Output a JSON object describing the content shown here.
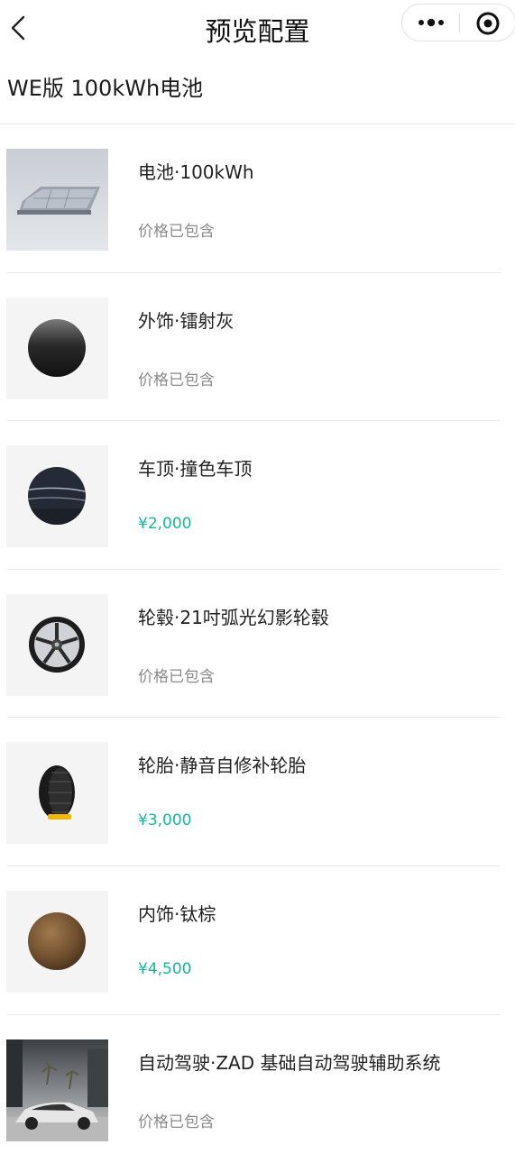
{
  "navbar": {
    "title": "预览配置",
    "back_icon": "chevron-left-icon",
    "more_icon": "more-dots-icon",
    "close_icon": "target-circle-icon"
  },
  "config": {
    "title": "WE版 100kWh电池"
  },
  "items": [
    {
      "name": "电池·100kWh",
      "price": "价格已包含",
      "paid": false,
      "icon": "battery-pack-image"
    },
    {
      "name": "外饰·镭射灰",
      "price": "价格已包含",
      "paid": false,
      "icon": "paint-swatch-laser-gray"
    },
    {
      "name": "车顶·撞色车顶",
      "price": "¥2,000",
      "paid": true,
      "icon": "paint-swatch-roof"
    },
    {
      "name": "轮毂·21吋弧光幻影轮毂",
      "price": "价格已包含",
      "paid": false,
      "icon": "wheel-rim-image"
    },
    {
      "name": "轮胎·静音自修补轮胎",
      "price": "¥3,000",
      "paid": true,
      "icon": "tire-image"
    },
    {
      "name": "内饰·钛棕",
      "price": "¥4,500",
      "paid": true,
      "icon": "interior-swatch-titanium-brown"
    },
    {
      "name": "自动驾驶·ZAD 基础自动驾驶辅助系统",
      "price": "价格已包含",
      "paid": false,
      "icon": "car-photo-image"
    }
  ],
  "colors": {
    "accent_price": "#13b89a",
    "included_price": "#8a8a8a"
  }
}
